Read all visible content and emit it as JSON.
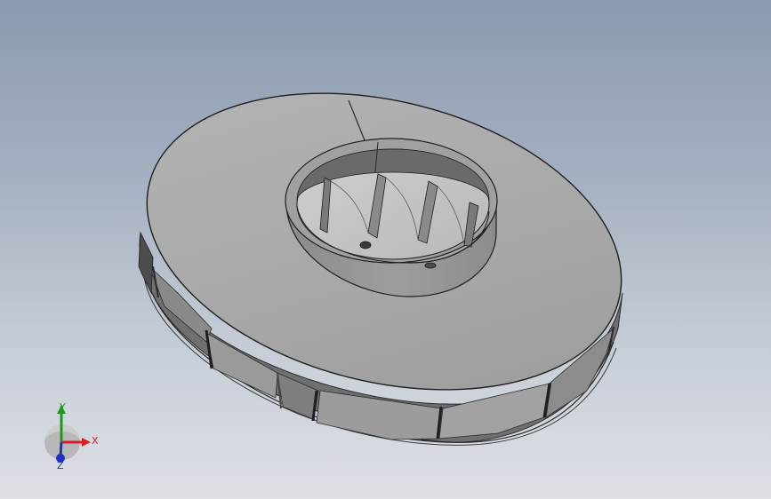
{
  "viewport": {
    "model": "impeller-model",
    "background_top": "#8a9ab0",
    "background_bottom": "#dde0e5"
  },
  "triad": {
    "x_label": "X",
    "y_label": "Y",
    "z_label": "Z",
    "x_color": "#d42020",
    "y_color": "#1a9a1a",
    "z_color": "#2030c0"
  }
}
